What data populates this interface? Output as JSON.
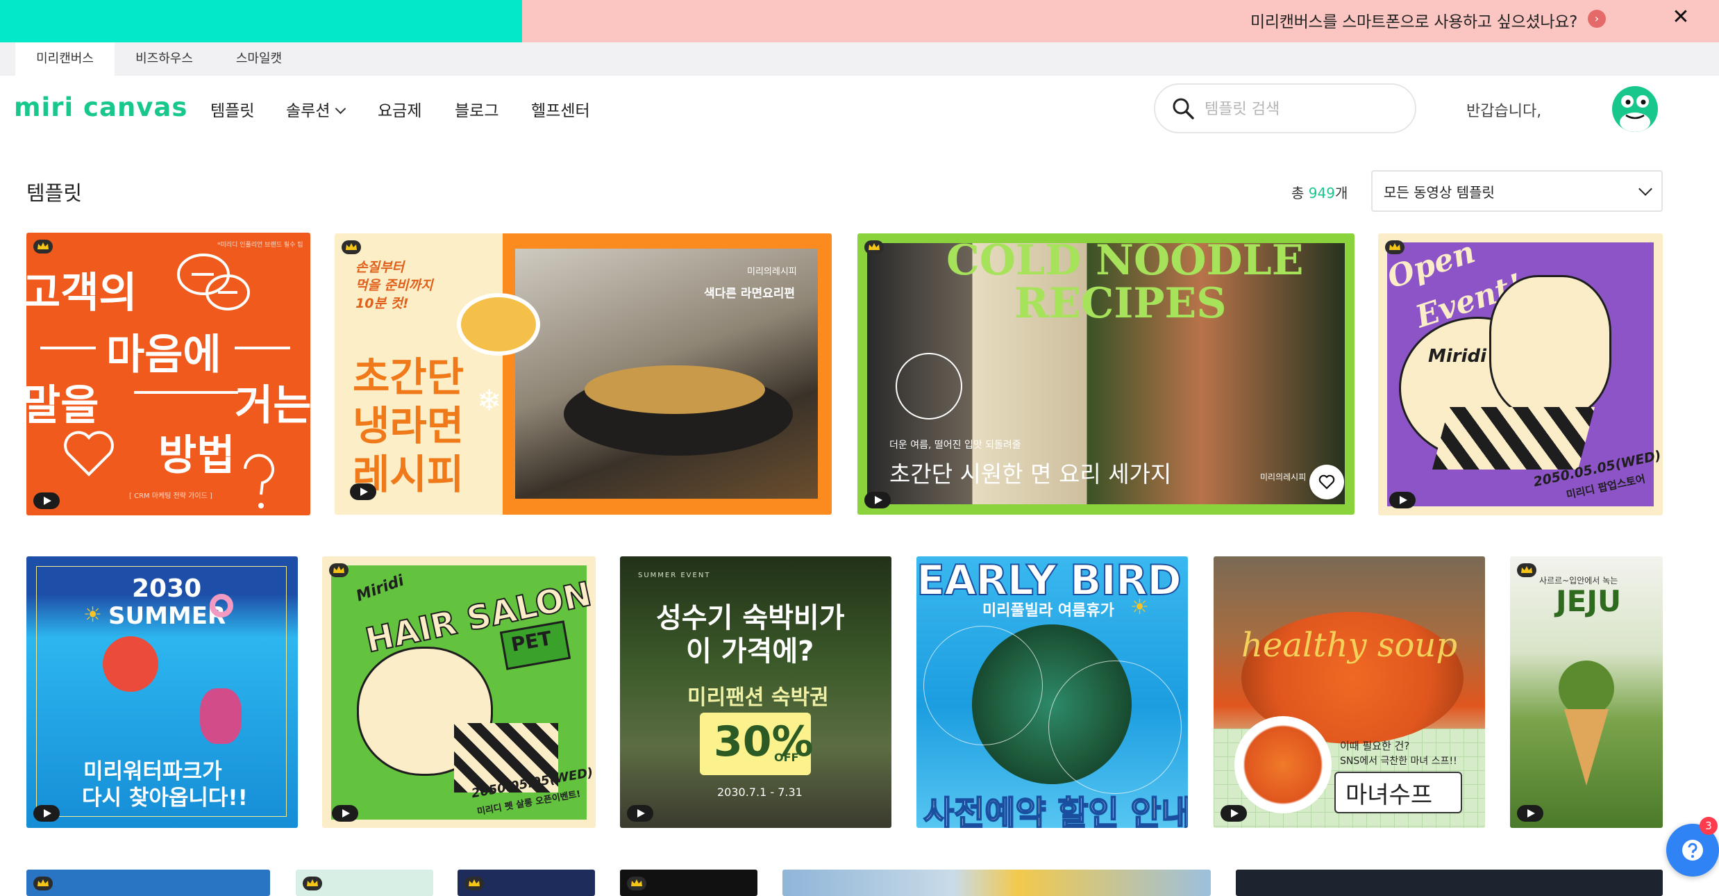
{
  "banner": {
    "text": "미리캔버스를 스마트폰으로 사용하고 싶으셨나요?",
    "close_icon": "close-icon",
    "arrow_icon": "chevron-right-icon",
    "colors": {
      "left": "#02e8c9",
      "right": "#fbc5c1"
    }
  },
  "service_tabs": [
    "미리캔버스",
    "비즈하우스",
    "스마일캣"
  ],
  "header": {
    "logo": "miri canvas",
    "nav": [
      "템플릿",
      "솔루션",
      "요금제",
      "블로그",
      "헬프센터"
    ],
    "search_placeholder": "템플릿 검색",
    "greeting": "반갑습니다,"
  },
  "section": {
    "title": "템플릿",
    "total_prefix": "총 ",
    "total_count": "949",
    "total_suffix": "개",
    "filter_value": "모든 동영상 템플릿"
  },
  "cards": {
    "c1": {
      "small": "*미리디 인풀리언 브랜드 필수 팁",
      "line1": "고객의",
      "line2": "마음에",
      "line3a": "말을",
      "line3b": "거는",
      "line4": "방법",
      "footer": "[ CRM 마케팅 전략 가이드 ]"
    },
    "c2": {
      "sub1": "손질부터",
      "sub2": "먹을 준비까지",
      "sub3": "10분 컷!",
      "t1": "초간단",
      "t2": "냉라면",
      "t3": "레시피",
      "brand": "미리의레시피",
      "caption": "색다른 라면요리편"
    },
    "c3": {
      "title1": "COLD NOODLE",
      "title2": "RECIPES",
      "sub": "더운 여름, 떨어진 입맛 되돌려줄",
      "main": "초간단 시원한 면 요리 세가지",
      "brand": "미리의레시피"
    },
    "c4": {
      "t1": "Open",
      "t2": "Event!",
      "brand": "Miridi",
      "date": "2050.05.05(WED)",
      "foot": "미리디 팝업스토어"
    },
    "c5": {
      "year": "2030",
      "word": "SUMMER",
      "l1": "미리워터파크가",
      "l2": "다시 찾아옵니다!!"
    },
    "c6": {
      "brand": "Miridi",
      "title": "HAIR SALON",
      "pet": "PET",
      "date": "2050.05.05(WED)",
      "foot": "미리디 펫 살롱 오픈이벤트!"
    },
    "c7": {
      "tag": "SUMMER EVENT",
      "l1": "성수기 숙박비가",
      "l2": "이 가격에?",
      "l3": "미리팬션 숙박권",
      "pct": "30%",
      "off": "OFF",
      "date": "2030.7.1 - 7.31"
    },
    "c8": {
      "title": "EARLY BIRD",
      "sub": "미리풀빌라 여름휴가",
      "foot": "사전예약 할인 안내"
    },
    "c9": {
      "title": "healthy soup",
      "q1": "이때 필요한 건?",
      "q2": "SNS에서 극찬한 마녀 스프!!",
      "name": "마녀수프"
    },
    "c10": {
      "top": "사르르~입안에서 녹는",
      "title": "JEJU"
    }
  },
  "help": {
    "badge": "3",
    "icon": "help-question-icon"
  }
}
